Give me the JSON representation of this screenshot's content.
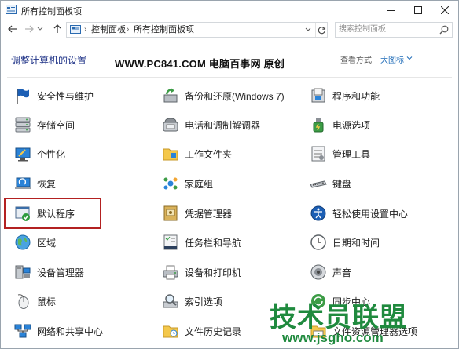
{
  "window": {
    "title": "所有控制面板项"
  },
  "address_bar": {
    "crumbs": [
      "控制面板",
      "所有控制面板项"
    ]
  },
  "search": {
    "placeholder": "搜索控制面板"
  },
  "header": {
    "title": "调整计算机的设置",
    "watermark": "WWW.PC841.COM 电脑百事网 原创",
    "view_by_label": "查看方式",
    "view_by_value": "大图标"
  },
  "items": [
    {
      "label": "安全性与维护",
      "icon": "flag-icon"
    },
    {
      "label": "存储空间",
      "icon": "storage-icon"
    },
    {
      "label": "个性化",
      "icon": "personalization-icon"
    },
    {
      "label": "恢复",
      "icon": "recovery-icon"
    },
    {
      "label": "默认程序",
      "icon": "default-programs-icon"
    },
    {
      "label": "区域",
      "icon": "globe-icon"
    },
    {
      "label": "设备管理器",
      "icon": "device-manager-icon"
    },
    {
      "label": "鼠标",
      "icon": "mouse-icon"
    },
    {
      "label": "网络和共享中心",
      "icon": "network-icon"
    },
    {
      "label": "备份和还原(Windows 7)",
      "icon": "backup-icon"
    },
    {
      "label": "电话和调制解调器",
      "icon": "phone-icon"
    },
    {
      "label": "工作文件夹",
      "icon": "folder-icon"
    },
    {
      "label": "家庭组",
      "icon": "homegroup-icon"
    },
    {
      "label": "凭据管理器",
      "icon": "credential-icon"
    },
    {
      "label": "任务栏和导航",
      "icon": "taskbar-icon"
    },
    {
      "label": "设备和打印机",
      "icon": "printer-icon"
    },
    {
      "label": "索引选项",
      "icon": "index-icon"
    },
    {
      "label": "文件历史记录",
      "icon": "file-history-icon"
    },
    {
      "label": "程序和功能",
      "icon": "programs-icon"
    },
    {
      "label": "电源选项",
      "icon": "power-icon"
    },
    {
      "label": "管理工具",
      "icon": "admin-tools-icon"
    },
    {
      "label": "键盘",
      "icon": "keyboard-icon"
    },
    {
      "label": "轻松使用设置中心",
      "icon": "ease-of-access-icon"
    },
    {
      "label": "日期和时间",
      "icon": "clock-icon"
    },
    {
      "label": "声音",
      "icon": "speaker-icon"
    },
    {
      "label": "同步中心",
      "icon": "sync-icon"
    },
    {
      "label": "文件资源管理器选项",
      "icon": "explorer-options-icon"
    }
  ],
  "brand_watermark": {
    "text": "技术员联盟",
    "url": "www.jsgho.com"
  },
  "colors": {
    "title": "#1e3287",
    "link": "#1e6bb8",
    "highlight_border": "#b32121",
    "brand": "#1f8a3e"
  }
}
